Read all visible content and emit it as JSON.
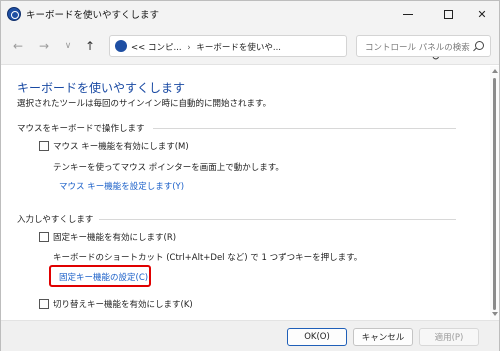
{
  "window": {
    "title": "キーボードを使いやすくします"
  },
  "nav": {
    "address_prefix": "<<",
    "address_part1": "コンピ...",
    "address_part2": "キーボードを使いや..."
  },
  "search": {
    "placeholder": "コントロール パネルの検索"
  },
  "page": {
    "title": "キーボードを使いやすくします",
    "description": "選択されたツールは毎回のサインイン時に自動的に開始されます。"
  },
  "sections": {
    "mouse_section_title": "マウスをキーボードで操作します",
    "mouse_keys_label": "マウス キー機能を有効にします(M)",
    "mouse_keys_desc": "テンキーを使ってマウス ポインターを画面上で動かします。",
    "mouse_keys_link": "マウス キー機能を設定します(Y)",
    "input_section_title": "入力しやすくします",
    "sticky_keys_label": "固定キー機能を有効にします(R)",
    "sticky_keys_desc": "キーボードのショートカット (Ctrl+Alt+Del など) で 1 つずつキーを押します。",
    "sticky_keys_link": "固定キー機能の設定(C)",
    "toggle_keys_label": "切り替えキー機能を有効にします(K)"
  },
  "footer": {
    "ok": "OK(O)",
    "cancel": "キャンセル",
    "apply": "適用(P)"
  },
  "colors": {
    "link": "#1a5fc8",
    "title": "#1a4aa3",
    "highlight": "#e00000"
  }
}
